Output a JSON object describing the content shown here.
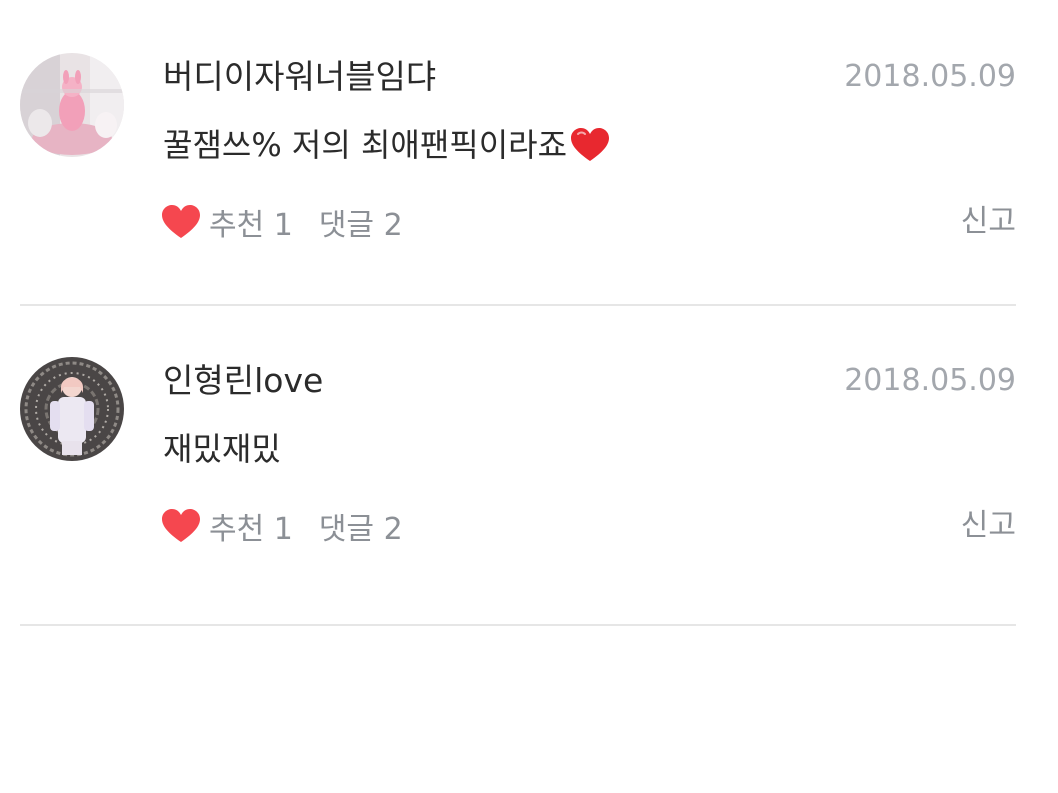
{
  "comments": [
    {
      "author": "버디이자워너블임댜",
      "date": "2018.05.09",
      "text": "꿀잼쓰% 저의 최애팬픽이라죠",
      "text_trailing_icon": "red-heart-emoji-icon",
      "like_label": "추천 1",
      "reply_label": "댓글 2",
      "report_label": "신고"
    },
    {
      "author": "인형린love",
      "date": "2018.05.09",
      "text": "재밌재밌",
      "like_label": "추천 1",
      "reply_label": "댓글 2",
      "report_label": "신고"
    }
  ],
  "colors": {
    "heart": "#f5474f",
    "meta_text": "#8c9096",
    "date_text": "#a3a7ad",
    "divider": "#e6e6e6"
  }
}
